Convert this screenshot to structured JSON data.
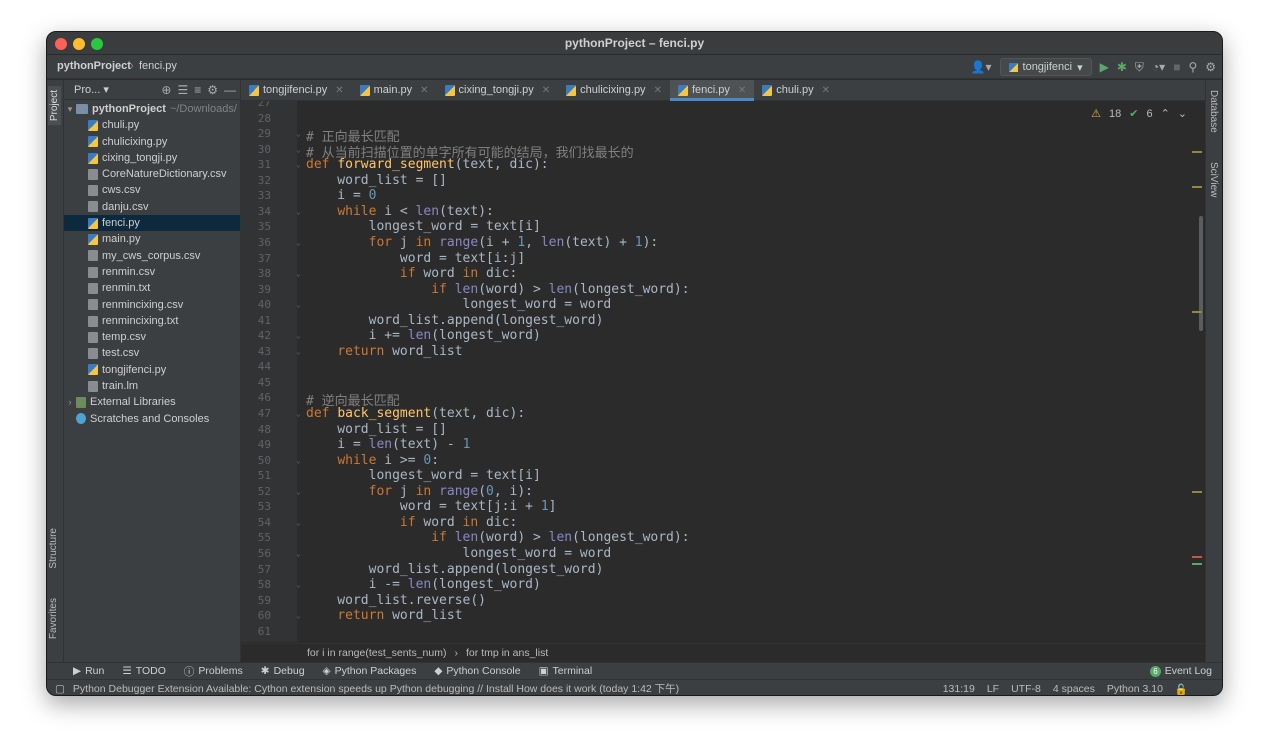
{
  "window": {
    "title": "pythonProject – fenci.py"
  },
  "navbar": {
    "project": "pythonProject",
    "file": "fenci.py",
    "run_config": "tongjifenci"
  },
  "left_tabs": {
    "project": "Project",
    "structure": "Structure",
    "favorites": "Favorites"
  },
  "right_tabs": {
    "database": "Database",
    "sciview": "SciView"
  },
  "project_panel": {
    "header": "Pro...",
    "root": {
      "name": "pythonProject",
      "path": "~/Downloads/"
    },
    "files": [
      {
        "name": "chuli.py",
        "type": "py"
      },
      {
        "name": "chulicixing.py",
        "type": "py"
      },
      {
        "name": "cixing_tongji.py",
        "type": "py"
      },
      {
        "name": "CoreNatureDictionary.csv",
        "type": "txt"
      },
      {
        "name": "cws.csv",
        "type": "txt"
      },
      {
        "name": "danju.csv",
        "type": "txt"
      },
      {
        "name": "fenci.py",
        "type": "py"
      },
      {
        "name": "main.py",
        "type": "py"
      },
      {
        "name": "my_cws_corpus.csv",
        "type": "txt"
      },
      {
        "name": "renmin.csv",
        "type": "txt"
      },
      {
        "name": "renmin.txt",
        "type": "txt"
      },
      {
        "name": "renmincixing.csv",
        "type": "txt"
      },
      {
        "name": "renmincixing.txt",
        "type": "txt"
      },
      {
        "name": "temp.csv",
        "type": "txt"
      },
      {
        "name": "test.csv",
        "type": "txt"
      },
      {
        "name": "tongjifenci.py",
        "type": "py"
      },
      {
        "name": "train.lm",
        "type": "txt"
      }
    ],
    "external_libraries": "External Libraries",
    "scratches": "Scratches and Consoles"
  },
  "tabs": [
    {
      "label": "tongjifenci.py",
      "active": false
    },
    {
      "label": "main.py",
      "active": false
    },
    {
      "label": "cixing_tongji.py",
      "active": false
    },
    {
      "label": "chulicixing.py",
      "active": false
    },
    {
      "label": "fenci.py",
      "active": true
    },
    {
      "label": "chuli.py",
      "active": false
    }
  ],
  "inspection": {
    "warnings": "18",
    "ok": "6"
  },
  "code": {
    "first_line_number": 27,
    "lines": [
      "",
      "",
      "# 正向最长匹配",
      "# 从当前扫描位置的单字所有可能的结局，我们找最长的",
      "def forward_segment(text, dic):",
      "    word_list = []",
      "    i = 0",
      "    while i < len(text):",
      "        longest_word = text[i]",
      "        for j in range(i + 1, len(text) + 1):",
      "            word = text[i:j]",
      "            if word in dic:",
      "                if len(word) > len(longest_word):",
      "                    longest_word = word",
      "        word_list.append(longest_word)",
      "        i += len(longest_word)",
      "    return word_list",
      "",
      "",
      "# 逆向最长匹配",
      "def back_segment(text, dic):",
      "    word_list = []",
      "    i = len(text) - 1",
      "    while i >= 0:",
      "        longest_word = text[i]",
      "        for j in range(0, i):",
      "            word = text[j:i + 1]",
      "            if word in dic:",
      "                if len(word) > len(longest_word):",
      "                    longest_word = word",
      "        word_list.append(longest_word)",
      "        i -= len(longest_word)",
      "    word_list.reverse()",
      "    return word_list",
      "",
      ""
    ]
  },
  "breadcrumb": {
    "first": "for i in range(test_sents_num)",
    "second": "for tmp in ans_list"
  },
  "toolwindows": {
    "run": "Run",
    "todo": "TODO",
    "problems": "Problems",
    "debug": "Debug",
    "python_packages": "Python Packages",
    "python_console": "Python Console",
    "terminal": "Terminal",
    "event_log": "Event Log",
    "event_log_count": "6"
  },
  "status": {
    "message": "Python Debugger Extension Available: Cython extension speeds up Python debugging // Install   How does it work (today 1:42 下午)",
    "position": "131:19",
    "line_sep": "LF",
    "encoding": "UTF-8",
    "indent": "4 spaces",
    "interpreter": "Python 3.10"
  },
  "colors": {
    "keyword": "#cc7832",
    "function": "#ffc66d",
    "number": "#6897bb",
    "comment": "#808080",
    "builtin": "#8888c6",
    "text": "#a9b7c6",
    "accent": "#4a88c7"
  }
}
